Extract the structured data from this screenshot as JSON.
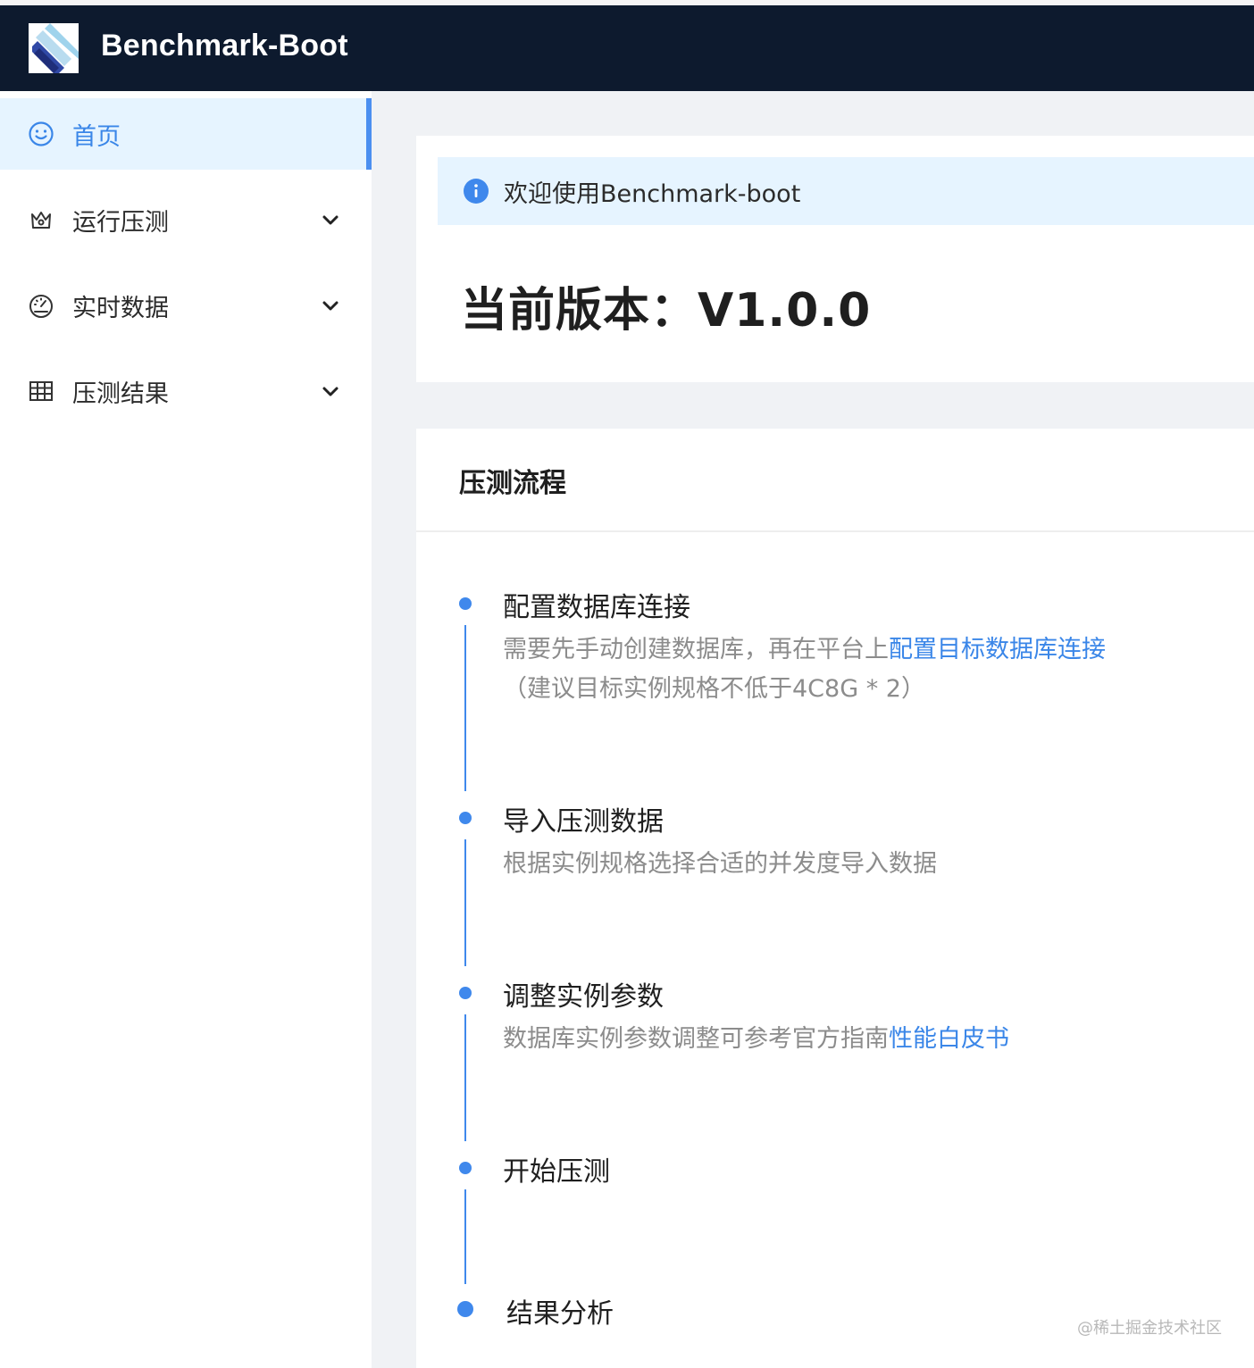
{
  "header": {
    "app_title": "Benchmark-Boot"
  },
  "sidebar": {
    "items": [
      {
        "label": "首页",
        "icon": "smile-icon",
        "active": true
      },
      {
        "label": "运行压测",
        "icon": "crown-icon",
        "expandable": true
      },
      {
        "label": "实时数据",
        "icon": "dashboard-icon",
        "expandable": true
      },
      {
        "label": "压测结果",
        "icon": "table-icon",
        "expandable": true
      }
    ]
  },
  "alert": {
    "text": "欢迎使用Benchmark-boot",
    "icon": "info-icon"
  },
  "version": {
    "text": "当前版本：V1.0.0"
  },
  "process": {
    "title": "压测流程",
    "steps": [
      {
        "title": "配置数据库连接",
        "desc_prefix": "需要先手动创建数据库，再在平台上",
        "desc_link": "配置目标数据库连接",
        "desc_line2": "（建议目标实例规格不低于4C8G * 2）"
      },
      {
        "title": "导入压测数据",
        "desc_prefix": "根据实例规格选择合适的并发度导入数据"
      },
      {
        "title": "调整实例参数",
        "desc_prefix": "数据库实例参数调整可参考官方指南",
        "desc_link": "性能白皮书"
      },
      {
        "title": "开始压测"
      },
      {
        "title": "结果分析"
      }
    ]
  },
  "watermark": "@稀土掘金技术社区",
  "colors": {
    "header_bg": "#0d1a2e",
    "accent": "#3a86e8",
    "active_bg": "#e6f4ff",
    "page_bg": "#f0f2f5"
  }
}
